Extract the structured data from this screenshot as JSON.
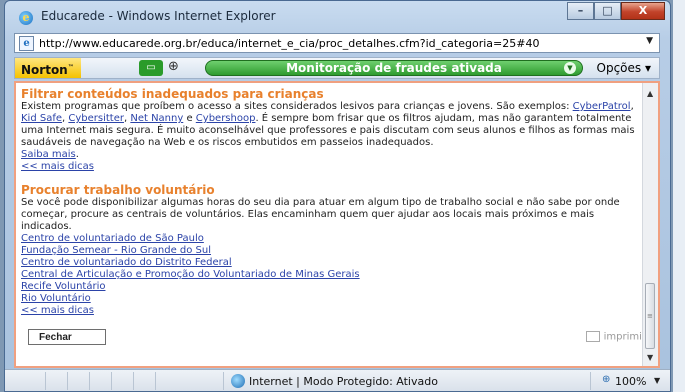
{
  "window": {
    "title": "Educarede - Windows Internet Explorer",
    "minimize": "–",
    "maximize": "□",
    "close": "X"
  },
  "address": {
    "url": "http://www.educarede.org.br/educa/internet_e_cia/proc_detalhes.cfm?id_categoria=25#40",
    "dropdown": "▼"
  },
  "norton": {
    "brand": "Norton",
    "tm": "™",
    "status": "Monitoração de fraudes ativada",
    "options": "Opções ▾"
  },
  "section1": {
    "title": "Filtrar conteúdos inadequados para crianças",
    "text_intro": "Existem programas que proíbem o acesso a sites considerados lesivos para crianças e jovens. São exemplos: ",
    "links": [
      "CyberPatrol",
      "Kid Safe",
      "Cybersitter",
      "Net Nanny",
      "Cybershoop"
    ],
    "sep_comma": ", ",
    "sep_and": " e ",
    "text_rest": ". É sempre bom frisar que os filtros ajudam, mas não garantem totalmente uma Internet mais segura. É muito aconselhável que professores e pais discutam com seus alunos e filhos as formas mais saudáveis de navegação na Web e os riscos embutidos em passeios inadequados.",
    "saiba_mais": "Saiba mais",
    "period": ".",
    "more": "<< mais dicas"
  },
  "section2": {
    "title": "Procurar trabalho voluntário",
    "text": "Se você pode disponibilizar algumas horas do seu dia para atuar em algum tipo de trabalho social e não sabe por onde começar, procure as centrais de voluntários. Elas encaminham quem quer ajudar aos locais mais próximos e mais indicados.",
    "links": [
      "Centro de voluntariado de São Paulo",
      "Fundação Semear - Rio Grande do Sul",
      "Centro de voluntariado do Distrito Federal",
      "Central de Articulação e Promoção do Voluntariado de Minas Gerais",
      "Recife Voluntário",
      "Rio Voluntário"
    ],
    "more": "<< mais dicas"
  },
  "actions": {
    "close": "Fechar",
    "print": "imprimir"
  },
  "statusbar": {
    "zone": "Internet | Modo Protegido: Ativado",
    "zoom": "100%"
  }
}
